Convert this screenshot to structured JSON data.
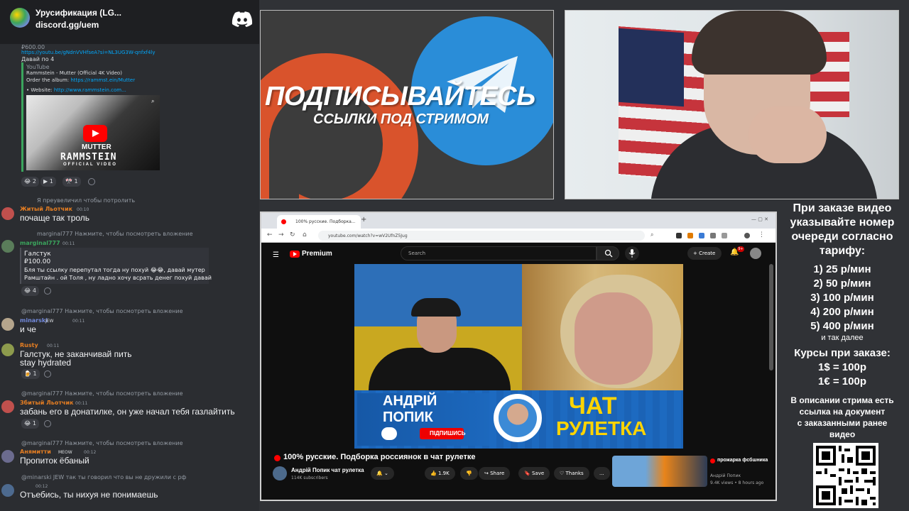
{
  "chat": {
    "server_title": "Урусификация (LG...",
    "invite": "discord.gg/uem",
    "embed_price": "₽600.00",
    "embed_link": "https://youtu.be/gNdnVVHfseA?si=NL3UG3W-qnfxf4ly",
    "embed_note": "Давай по 4",
    "embed_provider": "YouTube",
    "embed_title": "Rammstein - Mutter (Official 4K Video)",
    "embed_order_text": "Order the album:",
    "embed_order_link": "https://rammst.ein/Mutter",
    "embed_website_text": "• Website:",
    "embed_website_link": "http://www.rammstein.com...",
    "embed_thumb_word": "MUTTER",
    "embed_thumb_brand": "RAMMSTEIN",
    "embed_thumb_sub": "OFFICIAL VIDEO",
    "reactions_1": [
      "2",
      "1",
      "1"
    ],
    "messages": [
      {
        "reply": "Я преувеличил чтобы потролить",
        "user": "Житый Льотчик",
        "time": "00:10",
        "text": "почаще так троль"
      },
      {
        "reply": "marginal777 Нажмите, чтобы посмотреть вложение",
        "user": "marginal777",
        "time": "00:11",
        "donation_name": "Галстук",
        "donation_amount": "₽100.00",
        "donation_text_1": "Бля ты ссылку перепутал тогда ну похуй 😂😂, давай мутер",
        "donation_text_2": "Рамштайн . ой Толя , ну ладно хочу всрать денег похуй давай",
        "reaction": "4"
      },
      {
        "reply": "@marginal777 Нажмите, чтобы посмотреть вложение",
        "user": "minarski",
        "tag": "JEW",
        "time": "00:11",
        "text": "и че"
      },
      {
        "user": "Rusty",
        "time": "00:11",
        "text_1": "Галстук, не заканчивай пить",
        "text_2": "stay hydrated",
        "reaction": "1"
      },
      {
        "reply": "@marginal777 Нажмите, чтобы посмотреть вложение",
        "user": "Збитый Льотчик",
        "time": "00:11",
        "text": "забань его в донатилке, он уже начал тебя газлайтить",
        "reaction": "1"
      },
      {
        "reply": "@marginal777 Нажмите, чтобы посмотреть вложение",
        "user": "Анямитти",
        "tag": "MEOW",
        "time": "00:12",
        "text": "Пропиток ёбаный"
      },
      {
        "reply": "@minarski JEW так ты говорил что вы не дружили с рф",
        "time": "00:12",
        "text": "Отъебись, ты нихуя не понимаешь"
      }
    ]
  },
  "promo": {
    "headline": "ПОДПИСЫВАЙТЕСЬ",
    "subline": "ССЫЛКИ ПОД СТРИМОМ"
  },
  "browser": {
    "tab_title": "100% русские. Подборка...",
    "new_tab": "+",
    "url": "youtube.com/watch?v=wV2UfnZ5Jug",
    "yt_logo": "Premium",
    "search_placeholder": "Search",
    "create_label": "+ Create",
    "notif_count": "9+",
    "player_name_1": "АНДРІЙ",
    "player_name_2": "ПОПИК",
    "player_sub_btn": "ПІДПИШИСЬ",
    "player_chat": "ЧАТ",
    "player_ruletka": "РУЛЕТКА",
    "video_title": "100% русские. Подборка россиянок в чат рулетке",
    "channel_name": "Андрій Попик чат рулетка",
    "channel_subs": "114K subscribers",
    "like_count": "1.9K",
    "share_label": "Share",
    "save_label": "Save",
    "thanks_label": "Thanks",
    "more_label": "...",
    "related_title": "прожарка фсбшника",
    "related_channel": "Андрій Попик",
    "related_meta": "9.4K views • 8 hours ago"
  },
  "info": {
    "line1": "При заказе видео",
    "line2": "указывайте номер",
    "line3": "очереди согласно",
    "line4": "тарифу:",
    "tariffs": [
      "1) 25 р/мин",
      "2) 50 р/мин",
      "3) 100 р/мин",
      "4) 200 р/мин",
      "5) 400 р/мин"
    ],
    "etc": "и так далее",
    "rates_title": "Курсы при заказе:",
    "rate_usd": "1$ = 100р",
    "rate_eur": "1€ = 100р",
    "desc_1": "В описании стрима есть",
    "desc_2": "ссылка на документ",
    "desc_3": "с заказанными ранее",
    "desc_4": "видео"
  },
  "colors": {
    "discord_bg": "#2b2d31",
    "accent_red": "#ff0000",
    "promo_orange": "#d9532c",
    "promo_blue": "#2a8dd8",
    "banner_yellow": "#ffd400"
  }
}
